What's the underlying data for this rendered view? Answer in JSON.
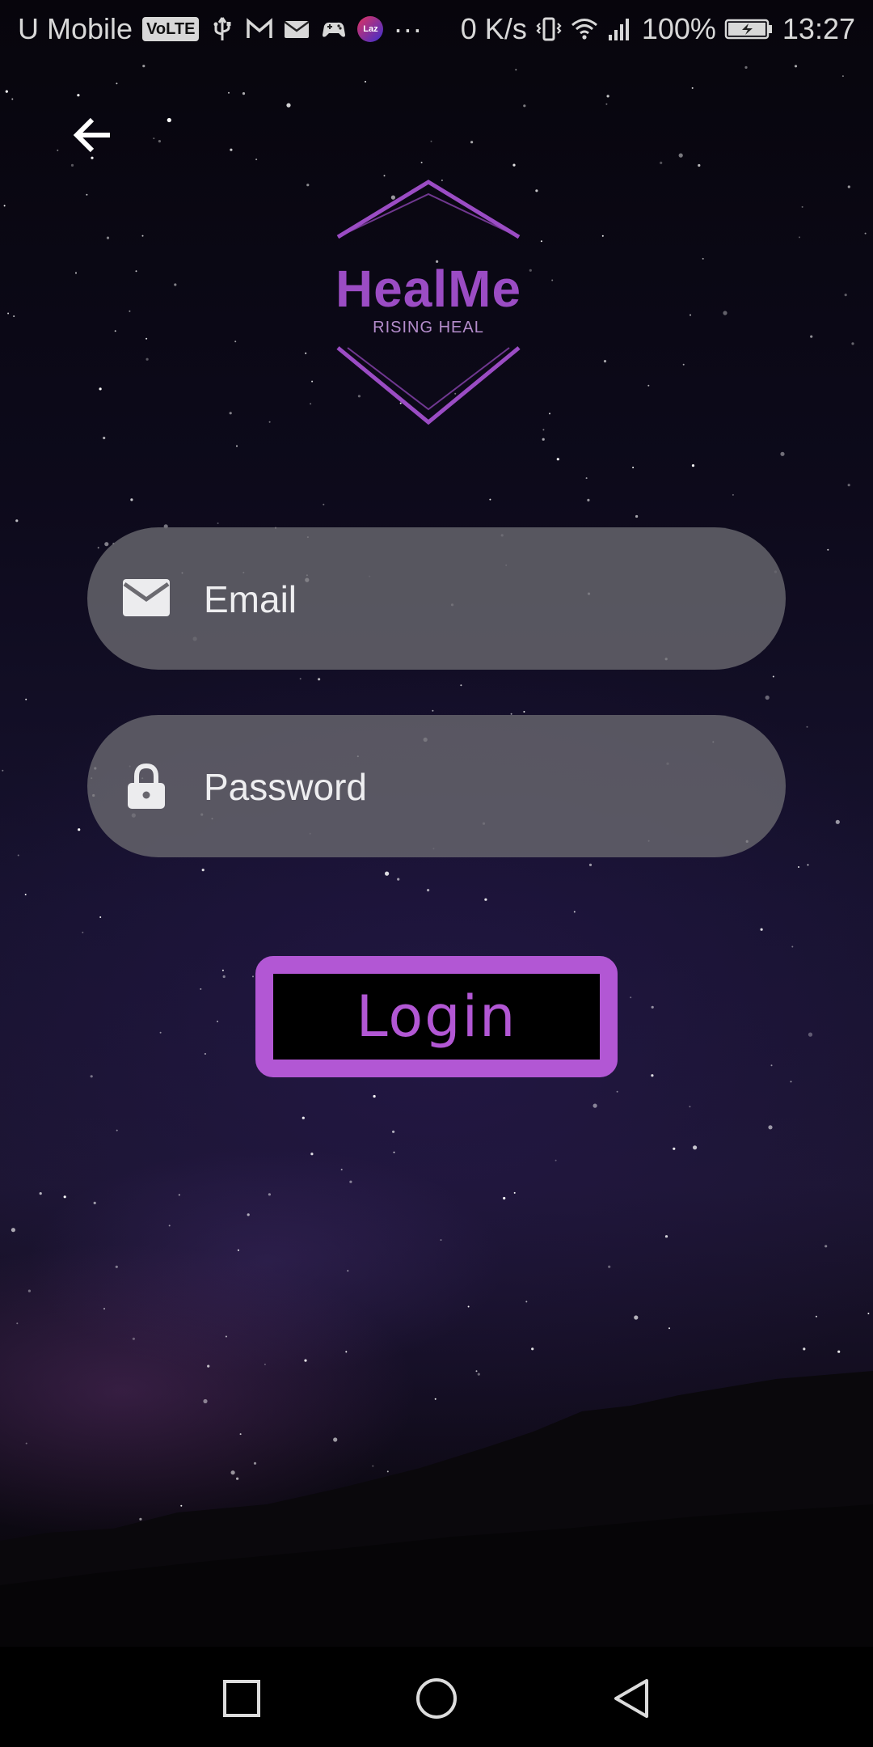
{
  "status_bar": {
    "carrier": "U Mobile",
    "volte": "VoLTE",
    "lazada": "Laz",
    "more": "···",
    "speed": "0 K/s",
    "battery": "100%",
    "time": "13:27"
  },
  "logo": {
    "title": "HealMe",
    "subtitle": "RISING HEAL"
  },
  "form": {
    "email_placeholder": "Email",
    "email_value": "",
    "password_placeholder": "Password",
    "password_value": "",
    "login_label": "Login"
  },
  "colors": {
    "accent": "#b257d4",
    "field_bg": "#68666e",
    "logo_purple": "#9b4cc4"
  },
  "icons": {
    "back": "arrow-left-icon",
    "email": "envelope-icon",
    "password": "lock-icon",
    "nav_recents": "square-icon",
    "nav_home": "circle-icon",
    "nav_back": "triangle-back-icon"
  }
}
